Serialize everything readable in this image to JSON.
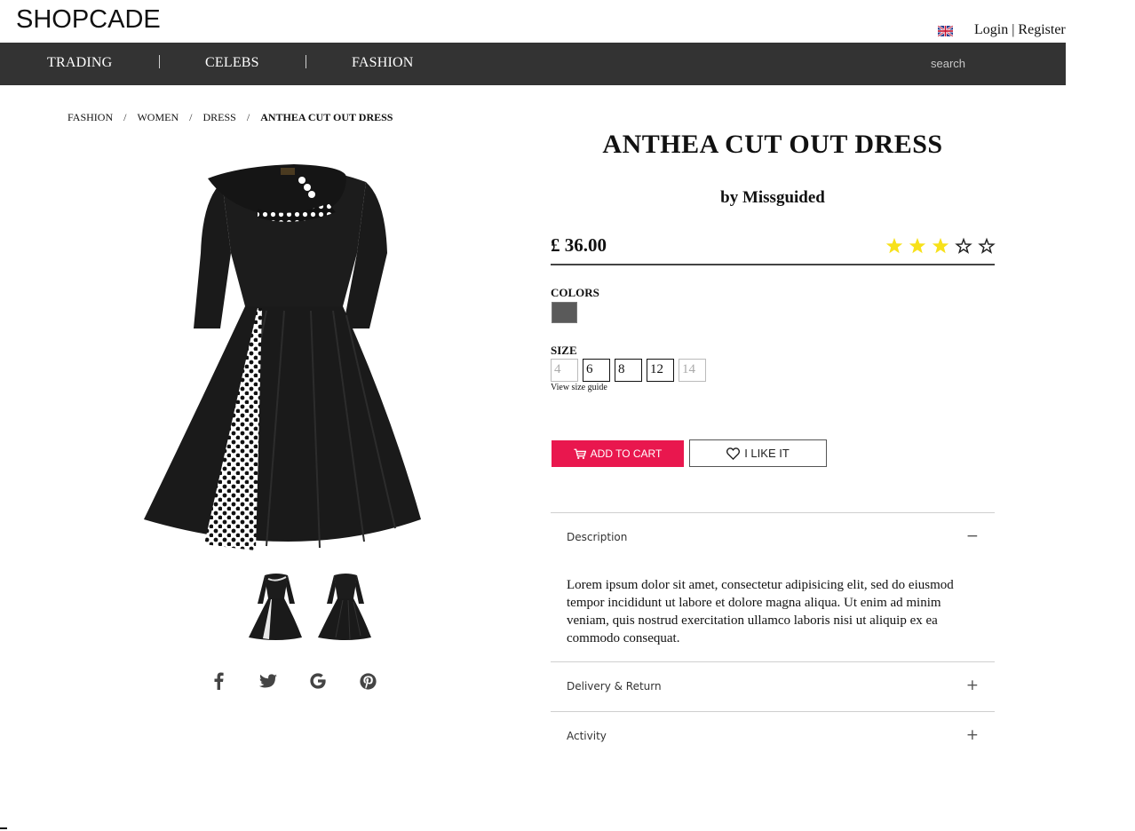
{
  "header": {
    "logo": "SHOPCADE",
    "login": "Login",
    "separator": "|",
    "register": "Register"
  },
  "nav": {
    "items": [
      "TRADING",
      "CELEBS",
      "FASHION"
    ],
    "search_placeholder": "search",
    "background": "#333333"
  },
  "breadcrumb": {
    "items": [
      "FASHION",
      "WOMEN",
      "DRESS"
    ],
    "current": "ANTHEA CUT OUT DRESS",
    "separator": "/"
  },
  "product": {
    "title": "ANTHEA CUT OUT DRESS",
    "brand": "by Missguided",
    "price": "£ 36.00",
    "rating": 3,
    "rating_max": 5,
    "colors_label": "COLORS",
    "colors": [
      "#5a5a5a"
    ],
    "size_label": "SIZE",
    "sizes": [
      {
        "label": "4",
        "available": false
      },
      {
        "label": "6",
        "available": true
      },
      {
        "label": "8",
        "available": true
      },
      {
        "label": "12",
        "available": true
      },
      {
        "label": "14",
        "available": false
      }
    ],
    "size_guide": "View size guide",
    "add_to_cart": "ADD TO CART",
    "like": "I LIKE IT",
    "accent_color": "#e9174e"
  },
  "accordion": {
    "description_title": "Description",
    "description_toggle": "−",
    "description_text": "Lorem ipsum dolor sit amet, consectetur adipisicing elit, sed do eiusmod tempor incididunt ut labore et dolore magna aliqua. Ut enim ad minim veniam, quis nostrud exercitation ullamco laboris nisi ut aliquip ex ea commodo consequat.",
    "delivery_title": "Delivery & Return",
    "delivery_toggle": "+",
    "activity_title": "Activity",
    "activity_toggle": "+"
  },
  "social": [
    "facebook-icon",
    "twitter-icon",
    "google-icon",
    "pinterest-icon"
  ]
}
